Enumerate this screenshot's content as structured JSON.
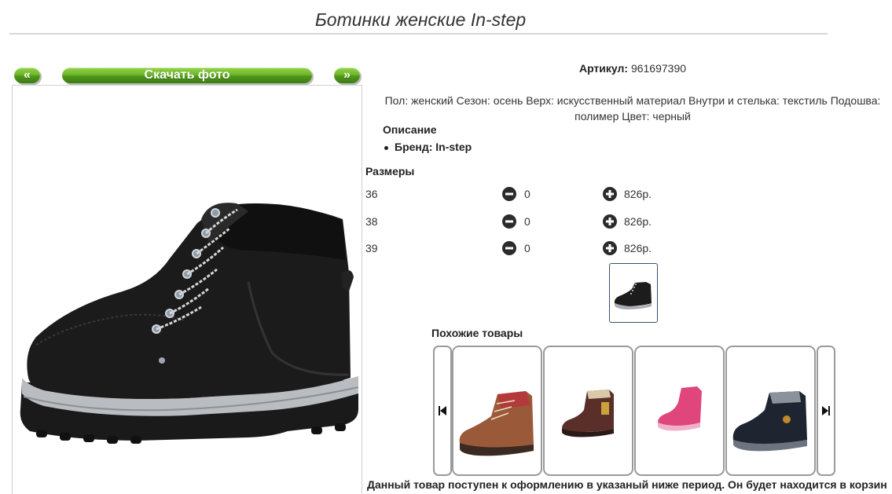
{
  "page": {
    "title": "Ботинки женские In-step"
  },
  "gallery": {
    "prev_label": "«",
    "download_label": "Скачать фото",
    "next_label": "»"
  },
  "product": {
    "article_label": "Артикул:",
    "article_value": "961697390",
    "properties_line1": "Пол: женский Сезон: осень Верх: искусственный материал Внутри и стелька: текстиль Подошва:",
    "properties_line2": "полимер Цвет: черный",
    "description_title": "Описание",
    "brand": "Бренд: In-step"
  },
  "sizes": {
    "title": "Размеры",
    "rows": [
      {
        "size": "36",
        "qty": "0",
        "price": "826р."
      },
      {
        "size": "38",
        "qty": "0",
        "price": "826р."
      },
      {
        "size": "39",
        "qty": "0",
        "price": "826р."
      }
    ]
  },
  "similar": {
    "title": "Похожие товары",
    "items": [
      {
        "icon": "brown-hiking-boot-image"
      },
      {
        "icon": "brown-kids-boot-image"
      },
      {
        "icon": "pink-sneaker-image"
      },
      {
        "icon": "black-winter-boot-image"
      }
    ]
  },
  "footer": {
    "text": "Данный товар поступен к оформлению в указаный ниже период. Он будет находится в корзин"
  },
  "colors": {
    "accent_green": "#6fb728",
    "border_gray": "#9a9a9a"
  }
}
